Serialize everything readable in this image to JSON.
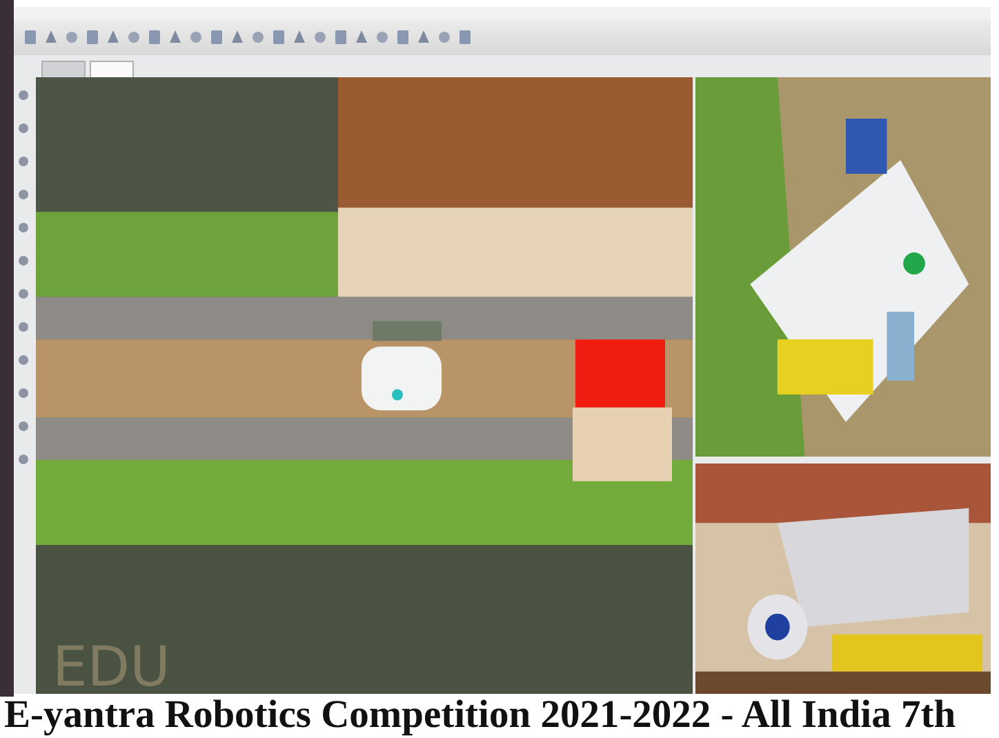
{
  "tabs": [
    {
      "selected": false
    },
    {
      "selected": true
    }
  ],
  "viewport": {
    "watermark": "EDU"
  },
  "caption": "E-yantra Robotics Competition 2021-2022 - All India 7th"
}
